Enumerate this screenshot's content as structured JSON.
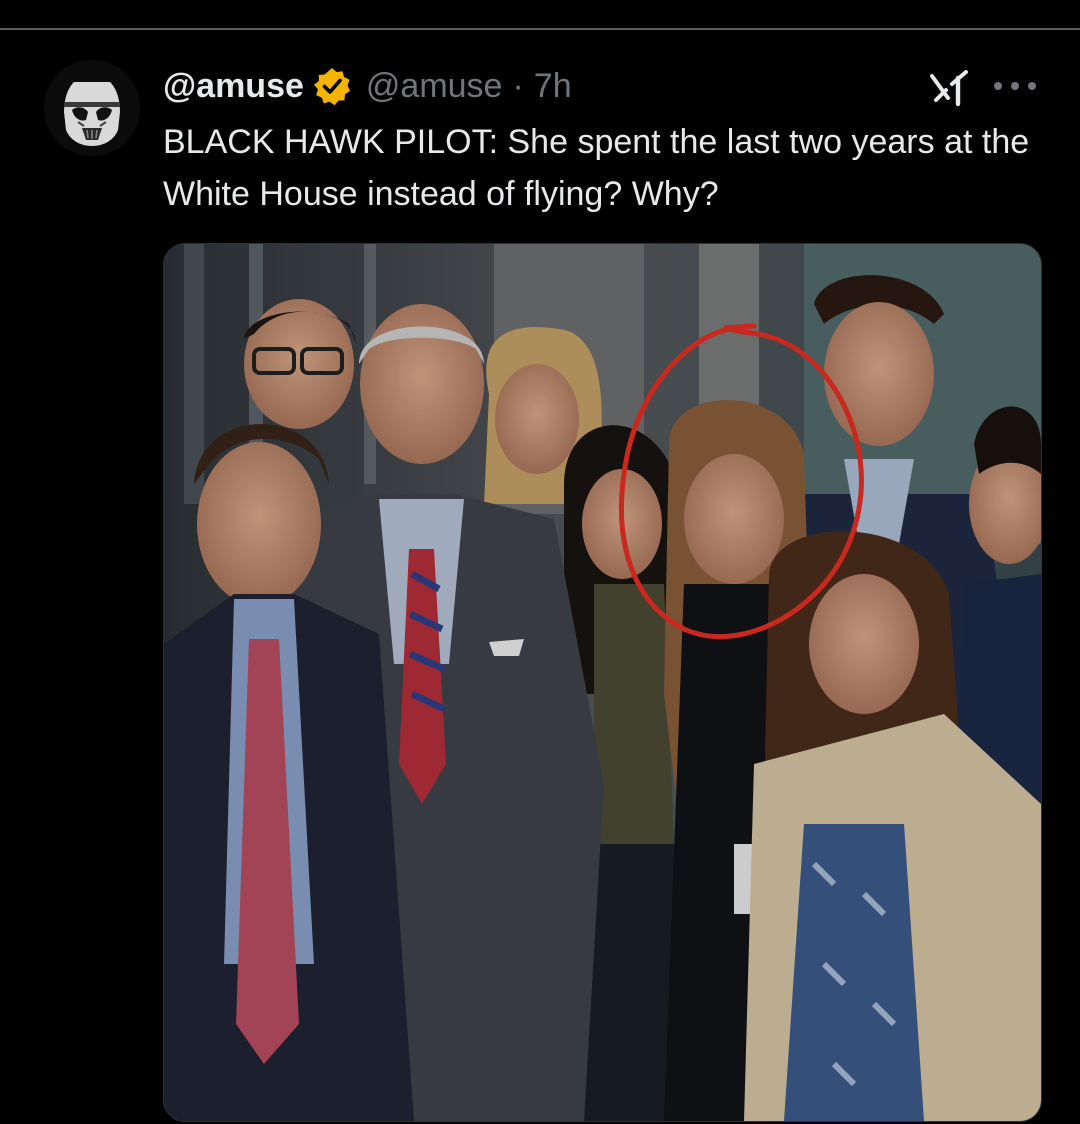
{
  "post": {
    "display_name": "@amuse",
    "handle": "@amuse",
    "separator": "·",
    "time": "7h",
    "text": "BLACK HAWK PILOT: She spent the last two years at the White House instead of flying? Why?",
    "verified_color": "#f4b400"
  },
  "icons": {
    "avatar": "stormtrooper-avatar",
    "verified": "verified-badge-icon",
    "grok": "grok-icon",
    "more": "more-icon"
  },
  "colors": {
    "background": "#000000",
    "text_primary": "#e7e9ea",
    "text_secondary": "#71767b",
    "annotation_circle": "#c8281e"
  }
}
